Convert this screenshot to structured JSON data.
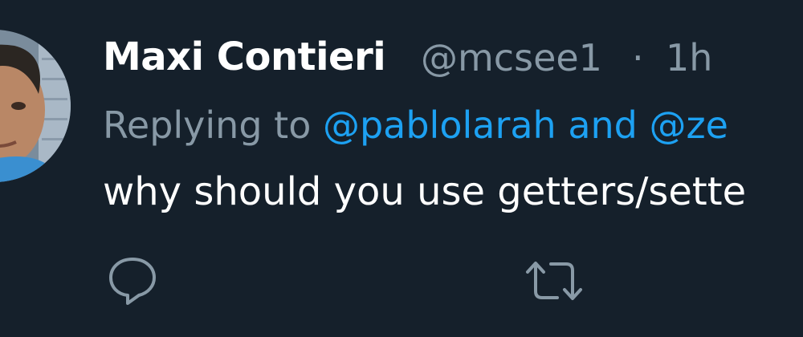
{
  "tweet": {
    "author_name": "Maxi Contieri",
    "author_handle": "@mcsee1",
    "separator": "·",
    "time_ago": "1h",
    "replying_to_prefix": "Replying to",
    "replying_to_mentions": "@pablolarah and @ze",
    "body": "why should you use getters/sette"
  },
  "icons": {
    "avatar": "user-avatar-photo",
    "reply": "reply-icon",
    "retweet": "retweet-icon"
  },
  "colors": {
    "background": "#15202b",
    "primary_text": "#ffffff",
    "secondary_text": "#8899a6",
    "link": "#1da1f2"
  }
}
